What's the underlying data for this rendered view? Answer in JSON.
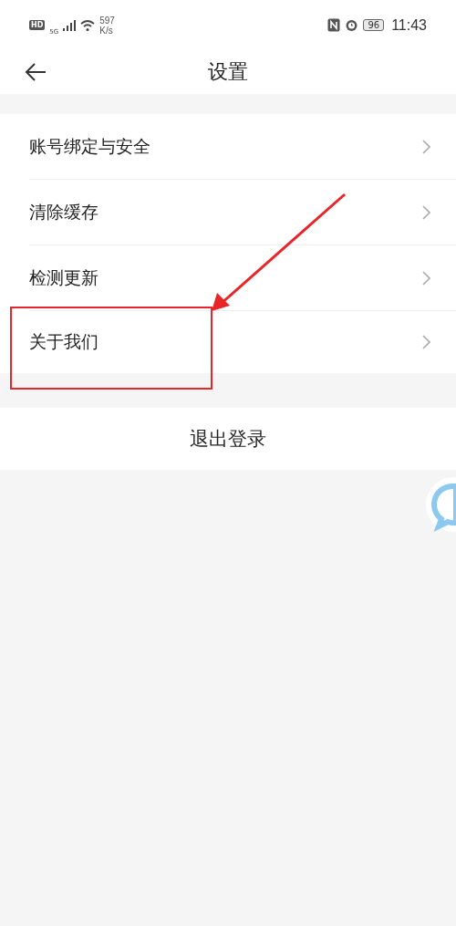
{
  "status_bar": {
    "network_badge": "HD",
    "network_type": "5G",
    "speed_value": "597",
    "speed_unit": "K/s",
    "battery": "96",
    "time": "11:43"
  },
  "header": {
    "title": "设置"
  },
  "menu_items": [
    {
      "label": "账号绑定与安全",
      "highlighted": false
    },
    {
      "label": "清除缓存",
      "highlighted": false
    },
    {
      "label": "检测更新",
      "highlighted": false
    },
    {
      "label": "关于我们",
      "highlighted": true
    }
  ],
  "logout_button": {
    "label": "退出登录"
  }
}
